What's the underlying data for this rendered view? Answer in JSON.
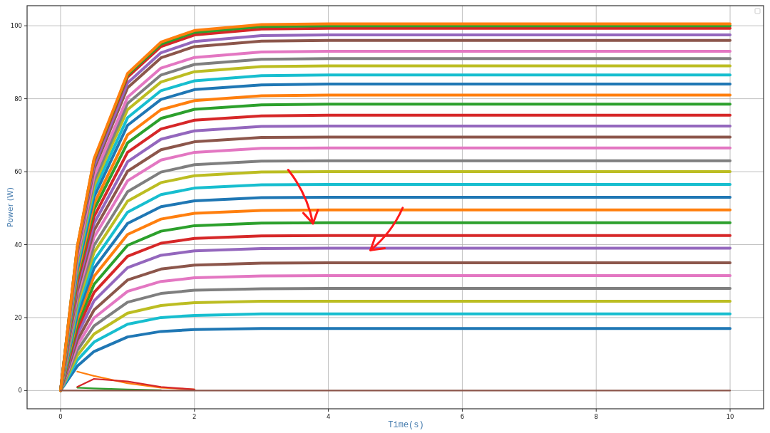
{
  "figure": {
    "chart_data": {
      "type": "line",
      "xlabel": "Time(s)",
      "ylabel": "Power (W)",
      "x": [
        0,
        0.25,
        0.5,
        1,
        1.5,
        2,
        3,
        4,
        5,
        6,
        7,
        8,
        9,
        10
      ],
      "xlim": [
        -0.5,
        10.5
      ],
      "ylim": [
        -5,
        105.5
      ],
      "xticks": [
        0,
        2,
        4,
        6,
        8,
        10
      ],
      "yticks": [
        0,
        20,
        40,
        60,
        80,
        100
      ],
      "series": [
        {
          "color": "#2ca02c",
          "values": [
            null,
            0.8,
            0.6,
            0.3,
            0.1,
            null,
            null,
            null,
            null,
            null,
            null,
            null,
            null,
            null
          ]
        },
        {
          "color": "#ff7f0e",
          "values": [
            null,
            5.2,
            4,
            2,
            0.8,
            0.3,
            null,
            null,
            null,
            null,
            null,
            null,
            null,
            null
          ]
        },
        {
          "color": "#d62728",
          "values": [
            null,
            1,
            3.2,
            2.5,
            1,
            0.3,
            null,
            null,
            null,
            null,
            null,
            null,
            null,
            null
          ]
        },
        {
          "color": "#1f77b4",
          "values": [
            0,
            6.7,
            10.7,
            14.7,
            16.2,
            16.7,
            17,
            17,
            17,
            17,
            17,
            17,
            17,
            17
          ]
        },
        {
          "color": "#17becf",
          "values": [
            0,
            8.3,
            13.3,
            18.2,
            20,
            20.6,
            21,
            21,
            21,
            21,
            21,
            21,
            21,
            21
          ]
        },
        {
          "color": "#bcbd22",
          "values": [
            0,
            9.6,
            15.5,
            21.2,
            23.3,
            24.1,
            24.5,
            24.5,
            24.5,
            24.5,
            24.5,
            24.5,
            24.5,
            24.5
          ]
        },
        {
          "color": "#7f7f7f",
          "values": [
            0,
            11,
            17.7,
            24.2,
            26.6,
            27.5,
            27.9,
            28,
            28,
            28,
            28,
            28,
            28,
            28
          ]
        },
        {
          "color": "#e377c2",
          "values": [
            0,
            12.4,
            19.9,
            27.2,
            29.9,
            30.9,
            31.4,
            31.5,
            31.5,
            31.5,
            31.5,
            31.5,
            31.5,
            31.5
          ]
        },
        {
          "color": "#8c564b",
          "values": [
            0,
            13.8,
            22.1,
            30.3,
            33.3,
            34.4,
            34.9,
            35,
            35,
            35,
            35,
            35,
            35,
            35
          ]
        },
        {
          "color": "#9467bd",
          "values": [
            0,
            15.3,
            24.6,
            33.7,
            37.1,
            38.3,
            38.9,
            39,
            39,
            39,
            39,
            39,
            39,
            39
          ]
        },
        {
          "color": "#d62728",
          "values": [
            0,
            16.7,
            26.9,
            36.8,
            40.4,
            41.7,
            42.4,
            42.5,
            42.5,
            42.5,
            42.5,
            42.5,
            42.5,
            42.5
          ]
        },
        {
          "color": "#2ca02c",
          "values": [
            0,
            18.1,
            29.1,
            39.8,
            43.7,
            45.2,
            45.9,
            46,
            46,
            46,
            46,
            46,
            46,
            46
          ]
        },
        {
          "color": "#ff7f0e",
          "values": [
            0,
            19.5,
            31.3,
            42.8,
            47,
            48.6,
            49.4,
            49.5,
            49.5,
            49.5,
            49.5,
            49.5,
            49.5,
            49.5
          ]
        },
        {
          "color": "#1f77b4",
          "values": [
            0,
            20.8,
            33.5,
            45.8,
            50.4,
            52,
            52.9,
            53,
            53,
            53,
            53,
            53,
            53,
            53
          ]
        },
        {
          "color": "#17becf",
          "values": [
            0,
            22.2,
            35.7,
            48.9,
            53.7,
            55.5,
            56.4,
            56.5,
            56.5,
            56.5,
            56.5,
            56.5,
            56.5,
            56.5
          ]
        },
        {
          "color": "#bcbd22",
          "values": [
            0,
            23.6,
            37.9,
            51.9,
            57,
            58.9,
            59.9,
            60,
            60,
            60,
            60,
            60,
            60,
            60
          ]
        },
        {
          "color": "#7f7f7f",
          "values": [
            0,
            24.8,
            39.8,
            54.5,
            59.9,
            61.9,
            62.9,
            63,
            63,
            63,
            63,
            63,
            63,
            63
          ]
        },
        {
          "color": "#e377c2",
          "values": [
            0,
            26.1,
            42,
            57.5,
            63.2,
            65.3,
            66.4,
            66.5,
            66.5,
            66.5,
            66.5,
            66.5,
            66.5,
            66.5
          ]
        },
        {
          "color": "#8c564b",
          "values": [
            0,
            27.3,
            43.9,
            60.1,
            66,
            68.2,
            69.4,
            69.5,
            69.5,
            69.5,
            69.5,
            69.5,
            69.5,
            69.5
          ]
        },
        {
          "color": "#9467bd",
          "values": [
            0,
            28.5,
            45.8,
            62.7,
            68.9,
            71.2,
            72.4,
            72.5,
            72.5,
            72.5,
            72.5,
            72.5,
            72.5,
            72.5
          ]
        },
        {
          "color": "#d62728",
          "values": [
            0,
            29.7,
            47.7,
            65.3,
            71.7,
            74.1,
            75.3,
            75.5,
            75.5,
            75.5,
            75.5,
            75.5,
            75.5,
            75.5
          ]
        },
        {
          "color": "#2ca02c",
          "values": [
            0,
            30.9,
            49.6,
            67.9,
            74.6,
            77.1,
            78.3,
            78.5,
            78.5,
            78.5,
            78.5,
            78.5,
            78.5,
            78.5
          ]
        },
        {
          "color": "#ff7f0e",
          "values": [
            0,
            31.8,
            51.2,
            70.1,
            77,
            79.5,
            80.8,
            81,
            81,
            81,
            81,
            81,
            81,
            81
          ]
        },
        {
          "color": "#1f77b4",
          "values": [
            0,
            33,
            53.1,
            72.7,
            79.8,
            82.5,
            83.8,
            84,
            84,
            84,
            84,
            84,
            84,
            84
          ]
        },
        {
          "color": "#17becf",
          "values": [
            0,
            34,
            54.7,
            74.8,
            82.2,
            84.9,
            86.3,
            86.5,
            86.5,
            86.5,
            86.5,
            86.5,
            86.5,
            86.5
          ]
        },
        {
          "color": "#bcbd22",
          "values": [
            0,
            35,
            56.2,
            77,
            84.6,
            87.4,
            88.8,
            89,
            89,
            89,
            89,
            89,
            89,
            89
          ]
        },
        {
          "color": "#7f7f7f",
          "values": [
            0,
            35.8,
            57.5,
            78.7,
            86.5,
            89.4,
            90.8,
            91,
            91,
            91,
            91,
            91,
            91,
            91
          ]
        },
        {
          "color": "#e377c2",
          "values": [
            0,
            36.5,
            58.8,
            80.4,
            88.4,
            91.3,
            92.8,
            93,
            93,
            93,
            93,
            93,
            93,
            93
          ]
        },
        {
          "color": "#8c564b",
          "values": [
            0,
            37.7,
            60.7,
            83,
            91.2,
            94.3,
            95.8,
            96,
            96,
            96,
            96,
            96,
            96,
            96
          ]
        },
        {
          "color": "#9467bd",
          "values": [
            0,
            38.3,
            61.6,
            84.3,
            92.6,
            95.7,
            97.3,
            97.5,
            97.5,
            97.5,
            97.5,
            97.5,
            97.5,
            97.5
          ]
        },
        {
          "color": "#d62728",
          "values": [
            0,
            39,
            62.8,
            85.9,
            94.3,
            97.5,
            99.1,
            99.3,
            99.3,
            99.3,
            99.3,
            99.3,
            99.3,
            99.3
          ]
        },
        {
          "color": "#2ca02c",
          "values": [
            0,
            39.3,
            63.2,
            86.5,
            95,
            98.2,
            99.8,
            100,
            100,
            100,
            100,
            100,
            100,
            100
          ]
        },
        {
          "color": "#ff7f0e",
          "values": [
            0,
            39.5,
            63.5,
            86.9,
            95.5,
            98.7,
            100.3,
            100.5,
            100.5,
            100.5,
            100.5,
            100.5,
            100.5,
            100.5
          ]
        },
        {
          "color": "#8c564b",
          "values": [
            0,
            0,
            0,
            0,
            0,
            0,
            0,
            0,
            0,
            0,
            0,
            0,
            0,
            0
          ]
        }
      ],
      "grid": true
    }
  }
}
